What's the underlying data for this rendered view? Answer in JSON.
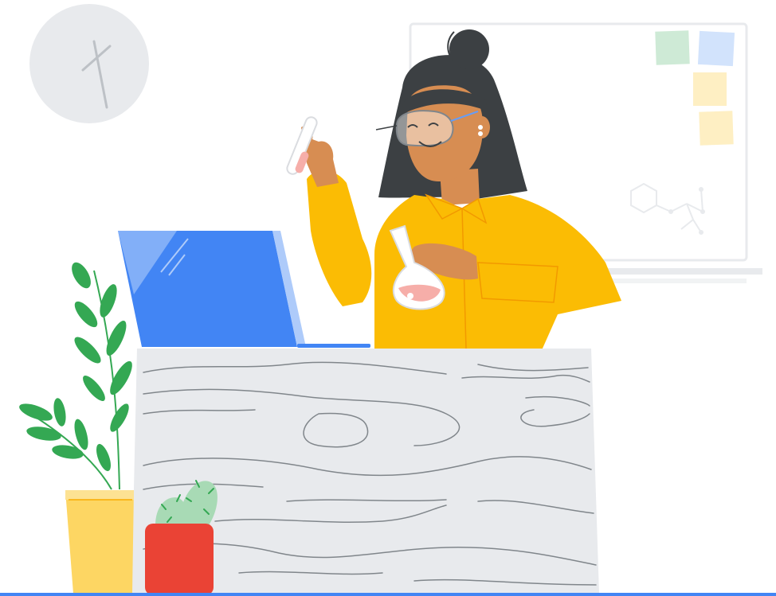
{
  "illustration": {
    "icons": {
      "clock": "wall-clock-icon",
      "whiteboard": "whiteboard-icon",
      "sticky_notes": "sticky-note-icon",
      "molecule": "molecule-icon",
      "scientist": "scientist-illustration",
      "laptop": "laptop-icon",
      "desk": "desk-icon",
      "plant": "potted-plant-icon",
      "cactus": "cactus-icon",
      "test_tube": "test-tube-icon",
      "flask": "flask-icon"
    },
    "colors": {
      "background": "#ffffff",
      "clock_face": "#e8eaed",
      "clock_hands": "#bdc1c6",
      "whiteboard_border": "#e8eaed",
      "sticky_green": "#ceead6",
      "sticky_blue": "#d2e3fc",
      "sticky_yellow": "#feefc3",
      "hair": "#3c4043",
      "skin": "#d78d52",
      "shirt": "#fbbc04",
      "shirt_shadow": "#f29900",
      "laptop_blue": "#4285f4",
      "laptop_light": "#aecbfa",
      "desk_top": "#e8eaed",
      "desk_grain": "#80868b",
      "leaf_green": "#34a853",
      "pot_yellow": "#fdd663",
      "cactus_green": "#a8dab5",
      "cactus_pot_red": "#ea4335",
      "liquid_pink": "#f6aea9",
      "floor_line": "#4285f4"
    }
  }
}
